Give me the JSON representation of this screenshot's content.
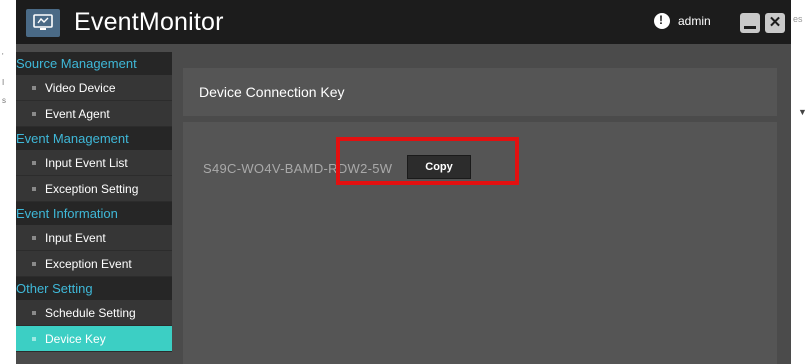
{
  "app": {
    "title": "EventMonitor",
    "user": "admin",
    "logo_icon": "monitor-app-icon",
    "accent": "#3ccfc4",
    "section_color": "#3fb8d8"
  },
  "background_fragments": {
    "right_corner_text": "es"
  },
  "sidebar": {
    "sections": [
      {
        "header": "Source Management",
        "items": [
          {
            "label": "Video Device"
          },
          {
            "label": "Event Agent"
          }
        ]
      },
      {
        "header": "Event Management",
        "items": [
          {
            "label": "Input Event List"
          },
          {
            "label": "Exception Setting"
          }
        ]
      },
      {
        "header": "Event Information",
        "items": [
          {
            "label": "Input Event"
          },
          {
            "label": "Exception Event"
          }
        ]
      },
      {
        "header": "Other Setting",
        "items": [
          {
            "label": "Schedule Setting"
          },
          {
            "label": "Device Key",
            "active": true
          }
        ]
      }
    ]
  },
  "main": {
    "heading": "Device Connection Key",
    "device_key": "S49C-WO4V-BAMD-RDW2-5W",
    "copy_label": "Copy",
    "highlight_color": "#e31010"
  }
}
